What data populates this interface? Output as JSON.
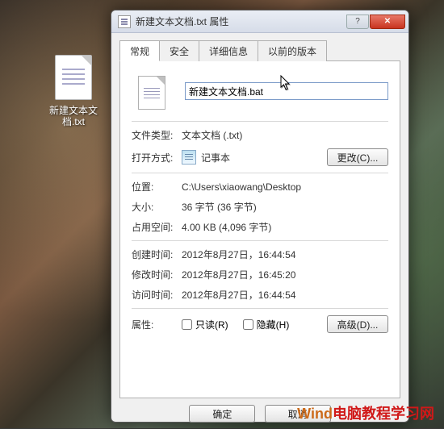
{
  "desktop": {
    "icon_label": "新建文本文档.txt"
  },
  "window": {
    "title": "新建文本文档.txt 属性",
    "tabs": [
      "常规",
      "安全",
      "详细信息",
      "以前的版本"
    ],
    "filename_value": "新建文本文档.bat",
    "labels": {
      "file_type": "文件类型:",
      "opens_with": "打开方式:",
      "location": "位置:",
      "size": "大小:",
      "size_on_disk": "占用空间:",
      "created": "创建时间:",
      "modified": "修改时间:",
      "accessed": "访问时间:",
      "attributes": "属性:"
    },
    "values": {
      "file_type": "文本文档 (.txt)",
      "opens_with": "记事本",
      "location": "C:\\Users\\xiaowang\\Desktop",
      "size": "36 字节 (36 字节)",
      "size_on_disk": "4.00 KB (4,096 字节)",
      "created": "2012年8月27日，16:44:54",
      "modified": "2012年8月27日，16:45:20",
      "accessed": "2012年8月27日，16:44:54"
    },
    "buttons": {
      "change": "更改(C)...",
      "advanced": "高级(D)...",
      "ok": "确定",
      "cancel": "取消"
    },
    "checkboxes": {
      "readonly": "只读(R)",
      "hidden": "隐藏(H)"
    }
  },
  "watermark": {
    "part1": "Wind",
    "part2": "电脑教程学习网"
  }
}
